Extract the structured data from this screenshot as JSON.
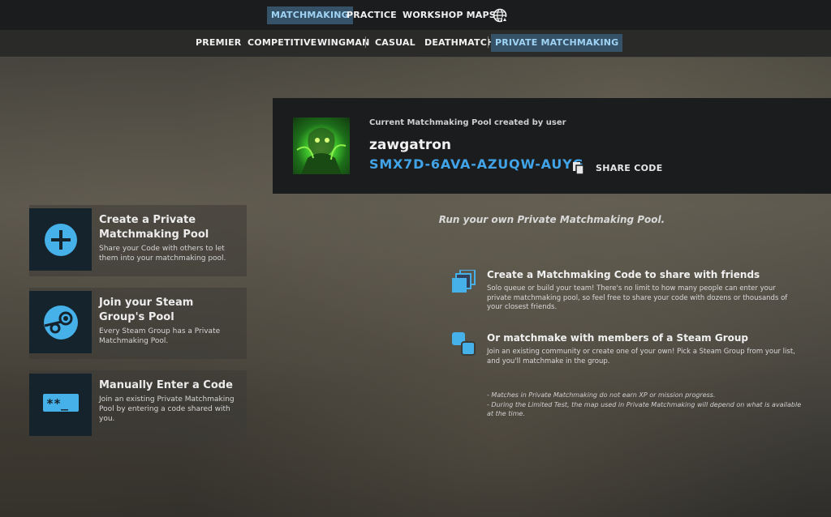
{
  "top_nav": {
    "tabs": [
      "MATCHMAKING",
      "PRACTICE",
      "WORKSHOP MAPS"
    ],
    "active": "MATCHMAKING",
    "globe_icon": "globe-icon"
  },
  "sub_nav": {
    "tabs": [
      "PREMIER",
      "COMPETITIVE",
      "WINGMAN",
      "CASUAL",
      "DEATHMATCH",
      "PRIVATE MATCHMAKING"
    ],
    "active": "PRIVATE MATCHMAKING"
  },
  "pool": {
    "caption": "Current Matchmaking Pool created by user",
    "username": "zawgatron",
    "code": "SMX7D-6AVA-AZUQW-AUYG",
    "share_label": "SHARE CODE"
  },
  "options": [
    {
      "icon": "plus-circle-icon",
      "title": "Create a Private Matchmaking Pool",
      "desc": "Share your Code with others to let them into your matchmaking pool."
    },
    {
      "icon": "steam-icon",
      "title": "Join your Steam Group's Pool",
      "desc": "Every Steam Group has a Private Matchmaking Pool."
    },
    {
      "icon": "password-icon",
      "title": "Manually Enter a Code",
      "desc": "Join an existing Private Matchmaking Pool by entering a code shared with you."
    }
  ],
  "info": {
    "tagline": "Run your own Private Matchmaking Pool.",
    "features": [
      {
        "icon": "stacked-squares-icon",
        "title": "Create a Matchmaking Code to share with friends",
        "desc": "Solo queue or build your team! There's no limit to how many people can enter your private matchmaking pool, so feel free to share your code with dozens or thousands of your closest friends."
      },
      {
        "icon": "group-squares-icon",
        "title": "Or matchmake with members of a Steam Group",
        "desc": "Join an existing community or create one of your own! Pick a Steam Group from your list, and you'll matchmake in the group."
      }
    ],
    "notes": [
      "- Matches in Private Matchmaking do not earn XP or mission progress.",
      "- During the Limited Test, the map used in Private Matchmaking will depend on what is available at the time."
    ]
  },
  "colors": {
    "accent": "#41a4e8",
    "active_tab_bg": "#365269",
    "icon_blue": "#46b0e8"
  }
}
